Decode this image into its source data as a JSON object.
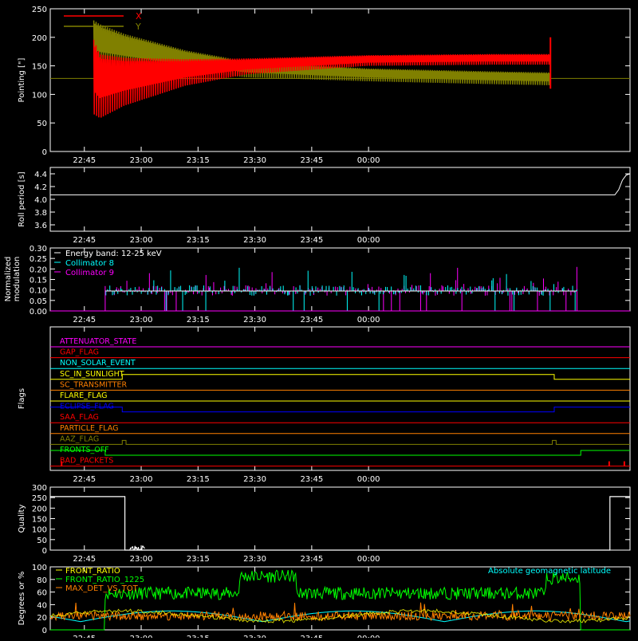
{
  "chart_data": [
    {
      "type": "line",
      "ylabel": "Pointing [\"]",
      "ylim": [
        0,
        250
      ],
      "yticks": [
        "0",
        "50",
        "100",
        "150",
        "200",
        "250"
      ],
      "xticks": [
        "22:45",
        "23:00",
        "23:15",
        "23:30",
        "23:45",
        "00:00"
      ],
      "series": [
        {
          "name": "X",
          "color": "#ff0000",
          "x_minutes": [
            0,
            2,
            10,
            30,
            50,
            90,
            130,
            150
          ],
          "center": [
            135,
            118,
            125,
            140,
            150,
            160,
            162,
            162
          ],
          "amplitude": [
            70,
            60,
            45,
            25,
            15,
            10,
            10,
            10
          ]
        },
        {
          "name": "Y",
          "color": "#808000",
          "x_minutes": [
            0,
            2,
            10,
            30,
            50,
            90,
            130,
            150
          ],
          "center": [
            195,
            190,
            180,
            160,
            145,
            135,
            130,
            128
          ],
          "amplitude": [
            40,
            38,
            30,
            20,
            15,
            12,
            12,
            12
          ]
        }
      ],
      "baseline": 128,
      "legend": "top-left"
    },
    {
      "type": "line",
      "ylabel": "Roll period [s]",
      "ylim": [
        3.5,
        4.5
      ],
      "yticks": [
        "3.6",
        "3.8",
        "4.0",
        "4.2",
        "4.4"
      ],
      "xticks": [
        "22:45",
        "23:00",
        "23:15",
        "23:30",
        "23:45",
        "00:00"
      ],
      "series": [
        {
          "name": "",
          "color": "#ffffff",
          "value": 4.07
        }
      ]
    },
    {
      "type": "bar",
      "ylabel": "Normalized modulation",
      "ylim": [
        0,
        0.3
      ],
      "yticks": [
        "0.00",
        "0.05",
        "0.10",
        "0.15",
        "0.20",
        "0.25",
        "0.30"
      ],
      "xticks": [
        "22:45",
        "23:00",
        "23:15",
        "23:30",
        "23:45",
        "00:00"
      ],
      "legend_title": "Energy band: 12-25 keV",
      "series": [
        {
          "name": "Collimator 8",
          "color": "#00ffff"
        },
        {
          "name": "Collimator 9",
          "color": "#ff00ff"
        }
      ],
      "baseline": 0.095
    },
    {
      "type": "line",
      "ylabel": "Flags",
      "xticks": [
        "22:45",
        "23:00",
        "23:15",
        "23:30",
        "23:45",
        "00:00"
      ],
      "flags": [
        {
          "name": "ATTENUATOR_STATE",
          "color": "#ff00ff"
        },
        {
          "name": "GAP_FLAG",
          "color": "#ff0000"
        },
        {
          "name": "NON_SOLAR_EVENT",
          "color": "#00ffff"
        },
        {
          "name": "SC_IN_SUNLIGHT",
          "color": "#ffff00"
        },
        {
          "name": "SC_TRANSMITTER",
          "color": "#ff8000"
        },
        {
          "name": "FLARE_FLAG",
          "color": "#ffff00"
        },
        {
          "name": "ECLIPSE_FLAG",
          "color": "#0000ff"
        },
        {
          "name": "SAA_FLAG",
          "color": "#ff0000"
        },
        {
          "name": "PARTICLE_FLAG",
          "color": "#ff8000"
        },
        {
          "name": "AAZ_FLAG",
          "color": "#808000"
        },
        {
          "name": "FRONTS_OFF",
          "color": "#00ff00"
        },
        {
          "name": "BAD_PACKETS",
          "color": "#ff0000"
        }
      ]
    },
    {
      "type": "line",
      "ylabel": "Quality",
      "ylim": [
        0,
        300
      ],
      "yticks": [
        "0",
        "50",
        "100",
        "150",
        "200",
        "250",
        "300"
      ],
      "xticks": [
        "22:45",
        "23:00",
        "23:15",
        "23:30",
        "23:45",
        "00:00"
      ],
      "series": [
        {
          "name": "",
          "color": "#ffffff",
          "x_minutes": [
            0,
            1.5,
            1.5,
            129.5,
            129.5,
            162
          ],
          "values": [
            255,
            255,
            0,
            0,
            255,
            255
          ]
        }
      ]
    },
    {
      "type": "line",
      "ylabel": "Degrees or %",
      "ylim": [
        0,
        100
      ],
      "yticks": [
        "0",
        "20",
        "40",
        "60",
        "80",
        "100"
      ],
      "xticks": [
        "22:45",
        "23:00",
        "23:15",
        "23:30",
        "23:45",
        "00:00"
      ],
      "series": [
        {
          "name": "FRONT_RATIO",
          "color": "#ffff00"
        },
        {
          "name": "FRONT_RATIO_1225",
          "color": "#00ff00"
        },
        {
          "name": "MAX_DET_VS_TOT",
          "color": "#ff8000"
        },
        {
          "name": "Absolute geomagnetic latitude",
          "color": "#00ffff"
        }
      ]
    }
  ]
}
